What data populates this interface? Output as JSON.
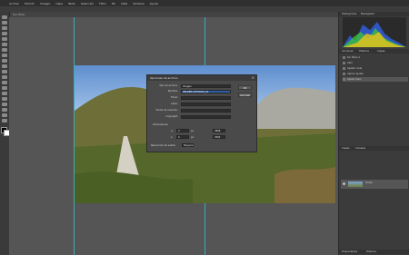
{
  "menubar": {
    "items": [
      "Archivo",
      "Edición",
      "Imagen",
      "Capa",
      "Texto",
      "Selección",
      "Filtro",
      "3D",
      "Vista",
      "Ventana",
      "Ayuda"
    ]
  },
  "document": {
    "tab_label": "Sin título"
  },
  "dialog": {
    "title": "Opciones de archivo",
    "fields": [
      {
        "label": "Tipo de archivo:",
        "value": "Imagen",
        "selected": false
      },
      {
        "label": "Nombre:",
        "value": "IMAGEN-ASTURIAS_01",
        "selected": true
      },
      {
        "label": "Título:",
        "value": "",
        "selected": false
      },
      {
        "label": "Autor:",
        "value": "",
        "selected": false
      },
      {
        "label": "Fecha de creación:",
        "value": "",
        "selected": false
      },
      {
        "label": "Copyright:",
        "value": "",
        "selected": false
      }
    ],
    "ok_label": "OK",
    "cancel_label": "Cancelar",
    "dimensions_label": "Dimensiones",
    "dims": [
      {
        "label": "A:",
        "value": "0",
        "unit": "px",
        "value2": "3888"
      },
      {
        "label": "L:",
        "value": "0",
        "unit": "px",
        "value2": "2592"
      }
    ],
    "resolution_label": "Resolución de salida:",
    "resolution_value": "Ninguna"
  },
  "panels": {
    "top_tabs": [
      "Histograma",
      "Navegador"
    ],
    "mid_tabs": [
      "Acciones",
      "Historia",
      "Capas"
    ],
    "history_items": [
      "Sin título-1",
      "Abrir",
      "Ajustar nivel",
      "Aplicar ajuste",
      "Ajuste claro"
    ],
    "layers_tabs": [
      "Capas",
      "Canales"
    ],
    "layer_name": "Fondo",
    "bottom_tabs": [
      "Propiedades",
      "Historia"
    ]
  }
}
